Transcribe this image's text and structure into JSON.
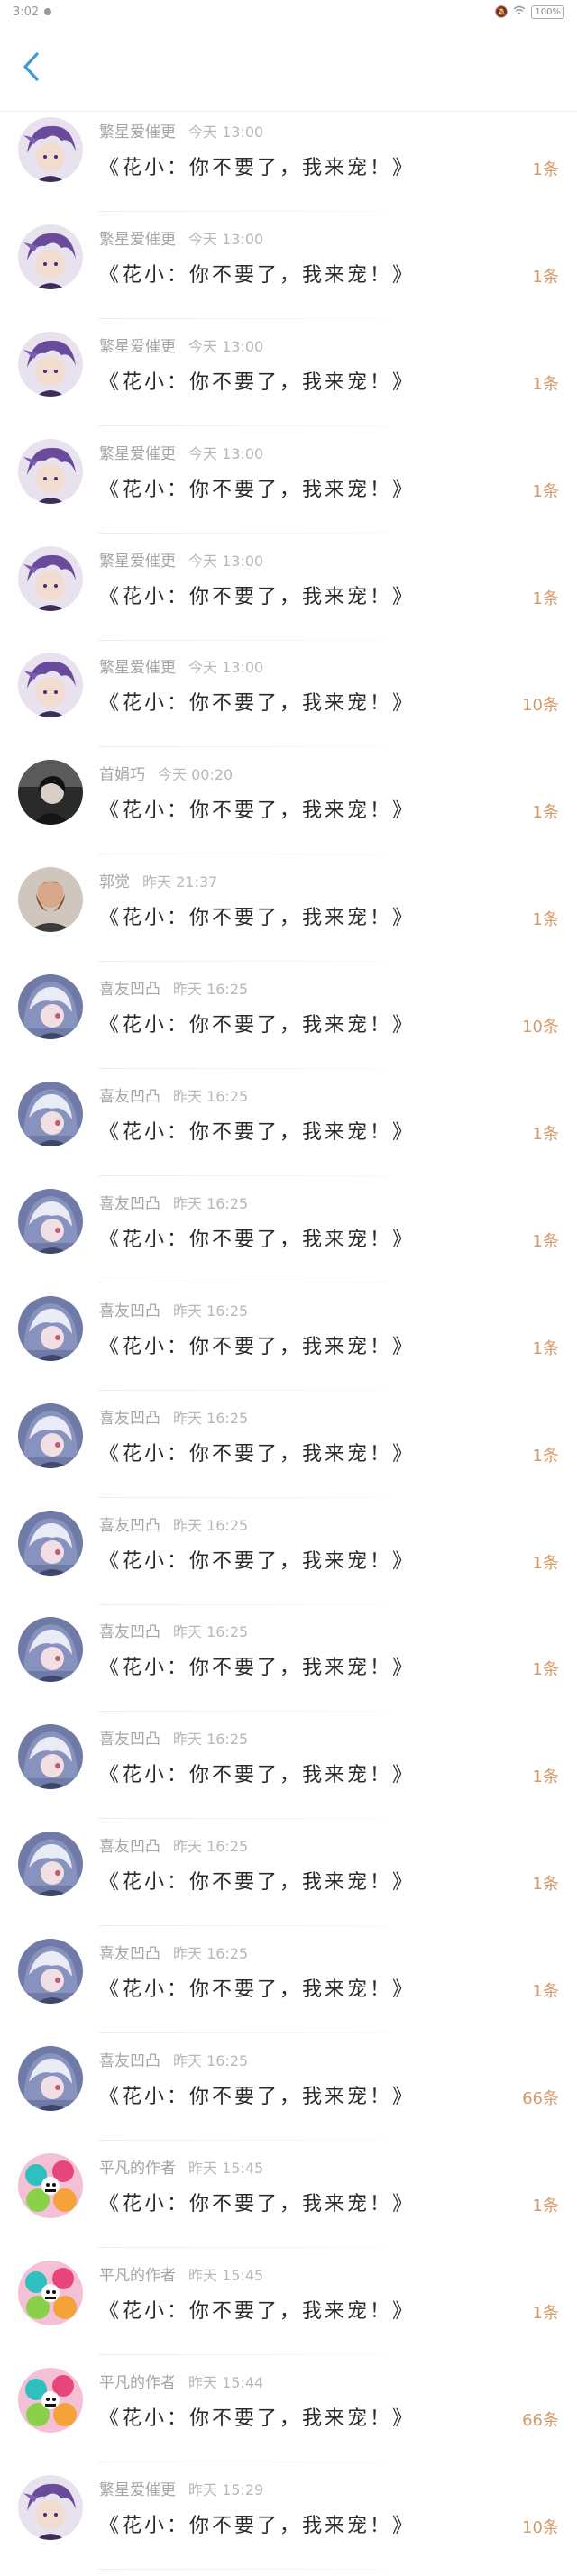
{
  "status_bar": {
    "time": "3:02",
    "battery": "100%"
  },
  "nav": {
    "back_icon": "chevron-left-icon",
    "accent": "#3a9bdc"
  },
  "messages": [
    {
      "name": "繁星爱催更",
      "time": "今天 13:00",
      "title": "《花小：你不要了，我来宠！》",
      "count": "1条",
      "avatar": "purple-hair"
    },
    {
      "name": "繁星爱催更",
      "time": "今天 13:00",
      "title": "《花小：你不要了，我来宠！》",
      "count": "1条",
      "avatar": "purple-hair"
    },
    {
      "name": "繁星爱催更",
      "time": "今天 13:00",
      "title": "《花小：你不要了，我来宠！》",
      "count": "1条",
      "avatar": "purple-hair"
    },
    {
      "name": "繁星爱催更",
      "time": "今天 13:00",
      "title": "《花小：你不要了，我来宠！》",
      "count": "1条",
      "avatar": "purple-hair"
    },
    {
      "name": "繁星爱催更",
      "time": "今天 13:00",
      "title": "《花小：你不要了，我来宠！》",
      "count": "1条",
      "avatar": "purple-hair"
    },
    {
      "name": "繁星爱催更",
      "time": "今天 13:00",
      "title": "《花小：你不要了，我来宠！》",
      "count": "10条",
      "avatar": "purple-hair"
    },
    {
      "name": "首娟巧",
      "time": "今天 00:20",
      "title": "《花小：你不要了，我来宠！》",
      "count": "1条",
      "avatar": "dark-figure"
    },
    {
      "name": "郭觉",
      "time": "昨天 21:37",
      "title": "《花小：你不要了，我来宠！》",
      "count": "1条",
      "avatar": "bearded-man"
    },
    {
      "name": "喜友凹凸",
      "time": "昨天 16:25",
      "title": "《花小：你不要了，我来宠！》",
      "count": "10条",
      "avatar": "hooded-anime"
    },
    {
      "name": "喜友凹凸",
      "time": "昨天 16:25",
      "title": "《花小：你不要了，我来宠！》",
      "count": "1条",
      "avatar": "hooded-anime"
    },
    {
      "name": "喜友凹凸",
      "time": "昨天 16:25",
      "title": "《花小：你不要了，我来宠！》",
      "count": "1条",
      "avatar": "hooded-anime"
    },
    {
      "name": "喜友凹凸",
      "time": "昨天 16:25",
      "title": "《花小：你不要了，我来宠！》",
      "count": "1条",
      "avatar": "hooded-anime"
    },
    {
      "name": "喜友凹凸",
      "time": "昨天 16:25",
      "title": "《花小：你不要了，我来宠！》",
      "count": "1条",
      "avatar": "hooded-anime"
    },
    {
      "name": "喜友凹凸",
      "time": "昨天 16:25",
      "title": "《花小：你不要了，我来宠！》",
      "count": "1条",
      "avatar": "hooded-anime"
    },
    {
      "name": "喜友凹凸",
      "time": "昨天 16:25",
      "title": "《花小：你不要了，我来宠！》",
      "count": "1条",
      "avatar": "hooded-anime"
    },
    {
      "name": "喜友凹凸",
      "time": "昨天 16:25",
      "title": "《花小：你不要了，我来宠！》",
      "count": "1条",
      "avatar": "hooded-anime"
    },
    {
      "name": "喜友凹凸",
      "time": "昨天 16:25",
      "title": "《花小：你不要了，我来宠！》",
      "count": "1条",
      "avatar": "hooded-anime"
    },
    {
      "name": "喜友凹凸",
      "time": "昨天 16:25",
      "title": "《花小：你不要了，我来宠！》",
      "count": "1条",
      "avatar": "hooded-anime"
    },
    {
      "name": "喜友凹凸",
      "time": "昨天 16:25",
      "title": "《花小：你不要了，我来宠！》",
      "count": "66条",
      "avatar": "hooded-anime"
    },
    {
      "name": "平凡的作者",
      "time": "昨天 15:45",
      "title": "《花小：你不要了，我来宠！》",
      "count": "1条",
      "avatar": "cartoon-collage"
    },
    {
      "name": "平凡的作者",
      "time": "昨天 15:45",
      "title": "《花小：你不要了，我来宠！》",
      "count": "1条",
      "avatar": "cartoon-collage"
    },
    {
      "name": "平凡的作者",
      "time": "昨天 15:44",
      "title": "《花小：你不要了，我来宠！》",
      "count": "66条",
      "avatar": "cartoon-collage"
    },
    {
      "name": "繁星爱催更",
      "time": "昨天 15:29",
      "title": "《花小：你不要了，我来宠！》",
      "count": "10条",
      "avatar": "purple-hair"
    }
  ]
}
